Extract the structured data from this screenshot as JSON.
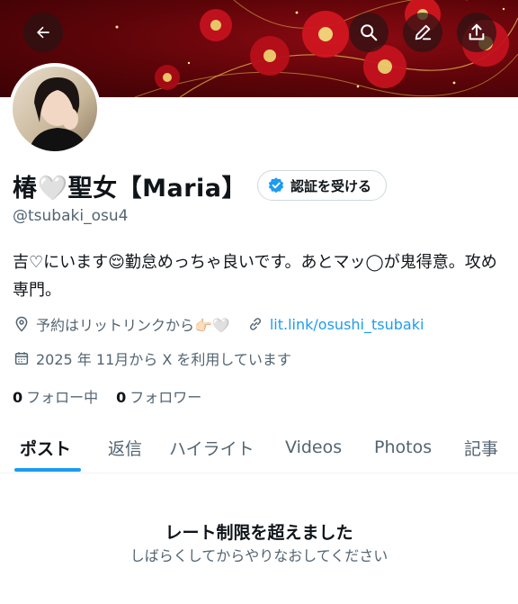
{
  "header": {
    "back_icon": "arrow-left-icon",
    "search_icon": "search-icon",
    "edit_icon": "pencil-icon",
    "share_icon": "share-upload-icon",
    "banner_colors": [
      "#5a0408",
      "#c4121e",
      "#f0c24a"
    ]
  },
  "profile": {
    "display_name": "椿🤍聖女【Maria】",
    "verify_button_label": "認証を受ける",
    "verify_icon": "verified-badge-icon",
    "handle": "@tsubaki_osu4",
    "bio": "吉♡にいます😌勤怠めっちゃ良いです。あとマッ◯が鬼得意。攻め専門。",
    "location": "予約はリットリンクから👉🏻🤍",
    "location_icon": "location-pin-icon",
    "link_text": "lit.link/osushi_tsubaki",
    "link_icon": "link-icon",
    "joined": "2025 年 11月から X を利用しています",
    "joined_icon": "calendar-icon",
    "following_count": "0",
    "following_label": "フォロー中",
    "followers_count": "0",
    "followers_label": "フォロワー"
  },
  "tabs": [
    {
      "label": "ポスト",
      "active": true
    },
    {
      "label": "返信",
      "active": false
    },
    {
      "label": "ハイライト",
      "active": false
    },
    {
      "label": "Videos",
      "active": false
    },
    {
      "label": "Photos",
      "active": false
    },
    {
      "label": "記事",
      "active": false
    }
  ],
  "message": {
    "title": "レート制限を超えました",
    "subtitle": "しばらくしてからやりなおしてください"
  },
  "colors": {
    "accent": "#1d9bf0",
    "text_primary": "#0f1419",
    "text_secondary": "#536471"
  }
}
